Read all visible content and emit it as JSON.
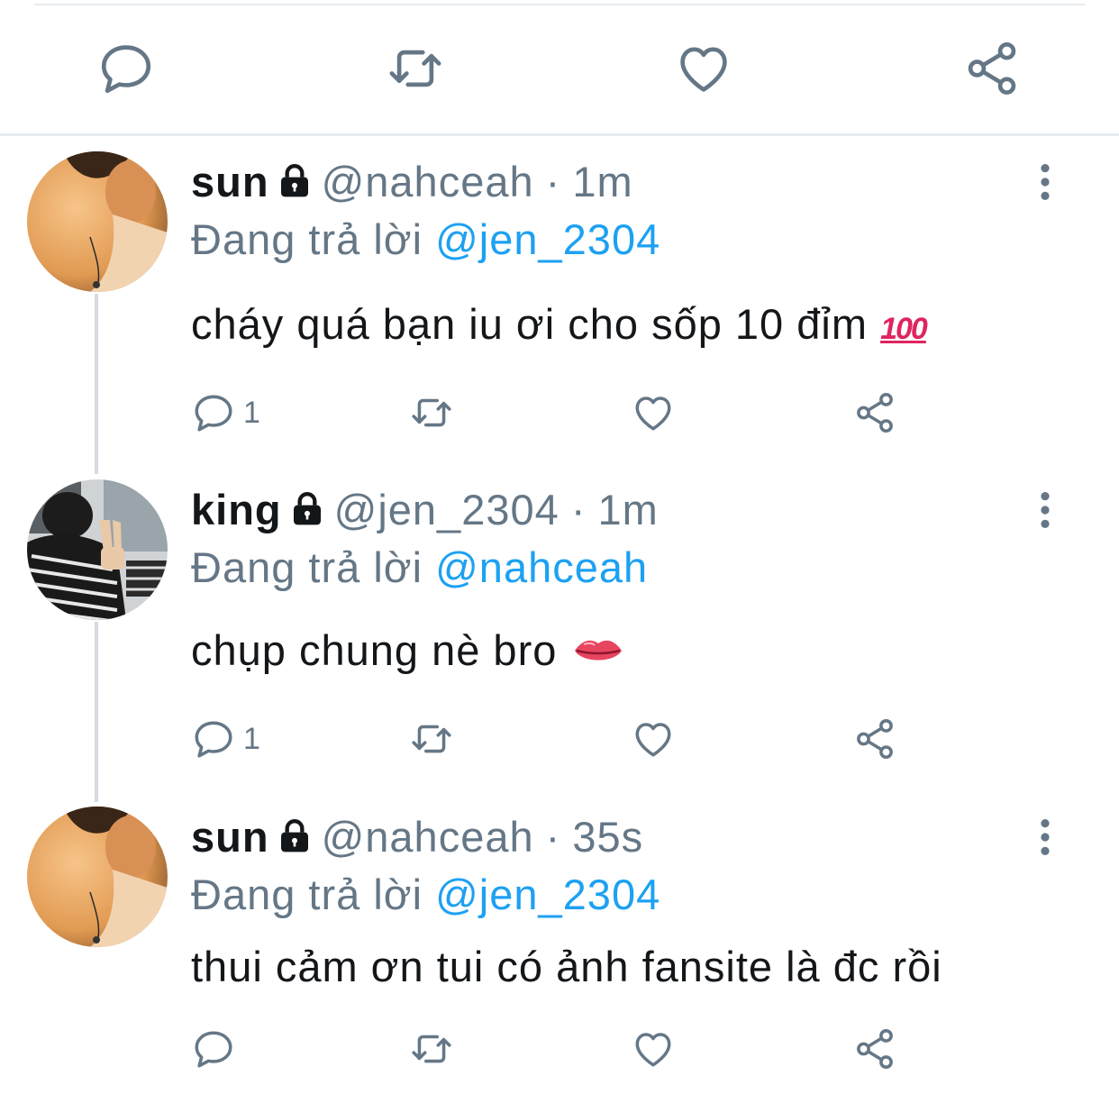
{
  "colors": {
    "accent": "#1da1f2",
    "secondary_text": "#657786",
    "primary_text": "#14171a",
    "divider": "#e6ecf0"
  },
  "top_actions": [
    "reply-icon",
    "retweet-icon",
    "like-icon",
    "share-icon"
  ],
  "tweets": [
    {
      "name": "sun",
      "handle": "@nahceah",
      "separator": "·",
      "time": "1m",
      "replying_prefix": "Đang trả lời",
      "replying_to": "@jen_2304",
      "text": "cháy quá bạn iu ơi cho sốp 10 đỉm",
      "emoji": "100-emoji",
      "emoji_text": "100",
      "reply_count": "1"
    },
    {
      "name": "king",
      "handle": "@jen_2304",
      "separator": "·",
      "time": "1m",
      "replying_prefix": "Đang trả lời",
      "replying_to": "@nahceah",
      "text": "chụp chung nè bro",
      "emoji": "lips-emoji",
      "reply_count": "1"
    },
    {
      "name": "sun",
      "handle": "@nahceah",
      "separator": "·",
      "time": "35s",
      "replying_prefix": "Đang trả lời",
      "replying_to": "@jen_2304",
      "text": "thui cảm ơn tui có ảnh fansite là đc rồi",
      "reply_count": ""
    }
  ]
}
